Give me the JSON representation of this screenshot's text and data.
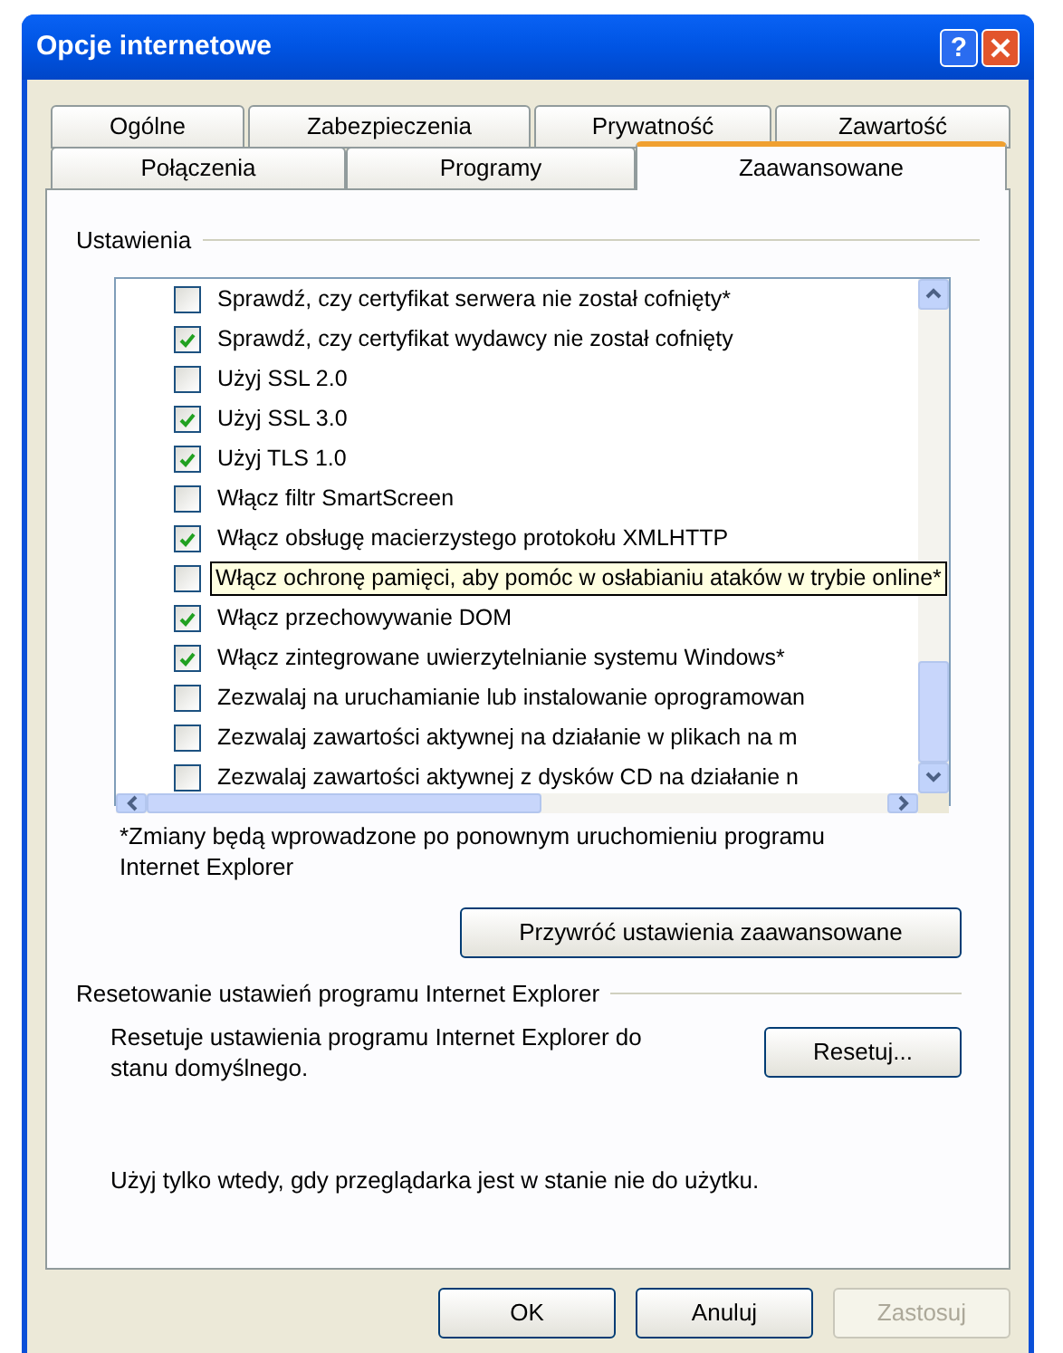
{
  "window": {
    "title": "Opcje internetowe",
    "help_button": "?"
  },
  "tabs": [
    [
      {
        "label": "Ogólne",
        "selected": false
      },
      {
        "label": "Zabezpieczenia",
        "selected": false
      },
      {
        "label": "Prywatność",
        "selected": false
      },
      {
        "label": "Zawartość",
        "selected": false
      }
    ],
    [
      {
        "label": "Połączenia",
        "selected": false
      },
      {
        "label": "Programy",
        "selected": false
      },
      {
        "label": "Zaawansowane",
        "selected": true
      }
    ]
  ],
  "settings": {
    "heading": "Ustawienia",
    "items": [
      {
        "label": "Sprawdź, czy certyfikat serwera nie został cofnięty*",
        "checked": false
      },
      {
        "label": "Sprawdź, czy certyfikat wydawcy nie został cofnięty",
        "checked": true
      },
      {
        "label": "Użyj SSL 2.0",
        "checked": false
      },
      {
        "label": "Użyj SSL 3.0",
        "checked": true
      },
      {
        "label": "Użyj TLS 1.0",
        "checked": true
      },
      {
        "label": "Włącz filtr SmartScreen",
        "checked": false
      },
      {
        "label": "Włącz obsługę macierzystego protokołu XMLHTTP",
        "checked": true
      },
      {
        "tooltip": "Włącz ochronę pamięci, aby pomóc w osłabianiu ataków w trybie online*",
        "checked": false
      },
      {
        "label": "Włącz przechowywanie DOM",
        "checked": true
      },
      {
        "label": "Włącz zintegrowane uwierzytelnianie systemu Windows*",
        "checked": true
      },
      {
        "label": "Zezwalaj na uruchamianie lub instalowanie oprogramowan",
        "checked": false
      },
      {
        "label": "Zezwalaj zawartości aktywnej na działanie w plikach na m",
        "checked": false
      },
      {
        "label": "Zezwalaj zawartości aktywnej z dysków CD na działanie n",
        "checked": false
      }
    ],
    "note": "*Zmiany będą wprowadzone po ponownym uruchomieniu programu Internet Explorer",
    "restore_button": "Przywróć ustawienia zaawansowane"
  },
  "reset": {
    "heading": "Resetowanie ustawień programu Internet Explorer",
    "description": "Resetuje ustawienia programu Internet Explorer do stanu domyślnego.",
    "button": "Resetuj...",
    "warning": "Użyj tylko wtedy, gdy przeglądarka jest w stanie nie do użytku."
  },
  "buttons": [
    {
      "label": "OK",
      "disabled": false
    },
    {
      "label": "Anuluj",
      "disabled": false
    },
    {
      "label": "Zastosuj",
      "disabled": true
    }
  ]
}
